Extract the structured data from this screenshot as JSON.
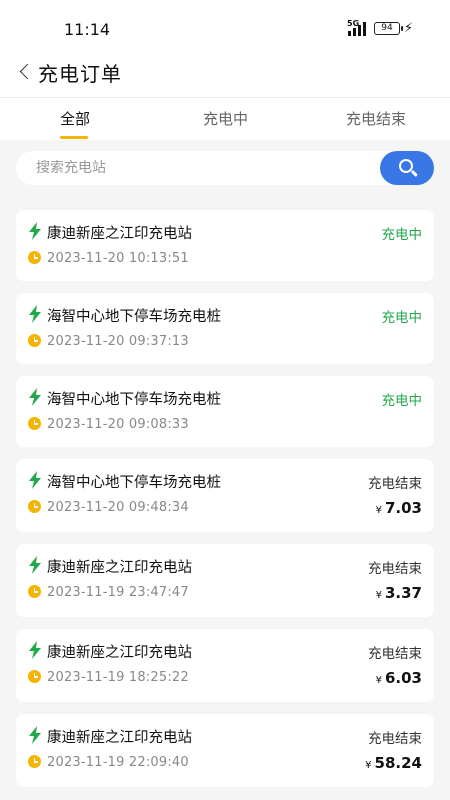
{
  "status_bar": {
    "time": "11:14",
    "network": "5G",
    "battery": "94"
  },
  "header": {
    "title": "充电订单"
  },
  "tabs": [
    {
      "label": "全部",
      "active": true
    },
    {
      "label": "充电中",
      "active": false
    },
    {
      "label": "充电结束",
      "active": false
    }
  ],
  "search": {
    "placeholder": "搜索充电站",
    "value": ""
  },
  "orders": [
    {
      "station": "康迪新座之江印充电站",
      "time": "2023-11-20 10:13:51",
      "status": "充电中",
      "state": "charging",
      "currency": "",
      "amount": ""
    },
    {
      "station": "海智中心地下停车场充电桩",
      "time": "2023-11-20 09:37:13",
      "status": "充电中",
      "state": "charging",
      "currency": "",
      "amount": ""
    },
    {
      "station": "海智中心地下停车场充电桩",
      "time": "2023-11-20 09:08:33",
      "status": "充电中",
      "state": "charging",
      "currency": "",
      "amount": ""
    },
    {
      "station": "海智中心地下停车场充电桩",
      "time": "2023-11-20 09:48:34",
      "status": "充电结束",
      "state": "done",
      "currency": "¥",
      "amount": "7.03"
    },
    {
      "station": "康迪新座之江印充电站",
      "time": "2023-11-19 23:47:47",
      "status": "充电结束",
      "state": "done",
      "currency": "¥",
      "amount": "3.37"
    },
    {
      "station": "康迪新座之江印充电站",
      "time": "2023-11-19 18:25:22",
      "status": "充电结束",
      "state": "done",
      "currency": "¥",
      "amount": "6.03"
    },
    {
      "station": "康迪新座之江印充电站",
      "time": "2023-11-19 22:09:40",
      "status": "充电结束",
      "state": "done",
      "currency": "¥",
      "amount": "58.24"
    }
  ],
  "colors": {
    "accent": "#f5b400",
    "charging": "#22a84b",
    "search_button": "#3a77e6",
    "bolt": "#22a84b"
  },
  "icons": {
    "back": "chevron-left-icon",
    "search": "search-icon",
    "station": "lightning-bolt-icon",
    "time": "clock-icon"
  }
}
